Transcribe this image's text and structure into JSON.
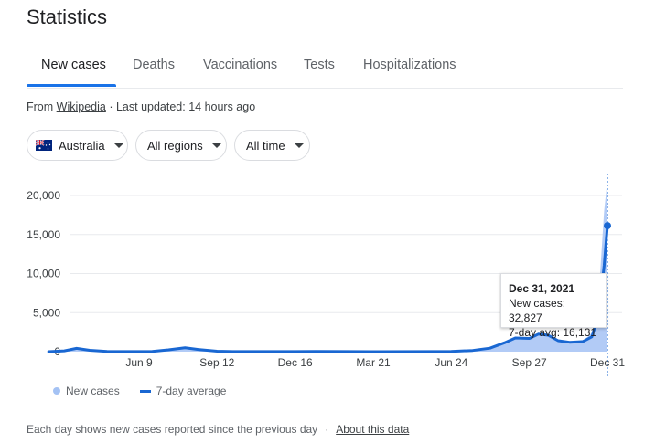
{
  "title": "Statistics",
  "tabs": [
    {
      "label": "New cases",
      "active": true
    },
    {
      "label": "Deaths",
      "active": false
    },
    {
      "label": "Vaccinations",
      "active": false
    },
    {
      "label": "Tests",
      "active": false
    },
    {
      "label": "Hospitalizations",
      "active": false
    }
  ],
  "source": {
    "prefix": "From",
    "link": "Wikipedia",
    "updated": "· Last updated: 14 hours ago"
  },
  "filters": {
    "country": "Australia",
    "region": "All regions",
    "time": "All time"
  },
  "tooltip": {
    "date": "Dec 31, 2021",
    "new_cases": "New cases: 32,827",
    "avg": "7-day avg: 16,131"
  },
  "legend": {
    "new_cases": "New cases",
    "avg": "7-day average"
  },
  "footer": {
    "note": "Each day shows new cases reported since the previous day",
    "separator": "·",
    "about": "About this data"
  },
  "colors": {
    "accent": "#1a73e8",
    "avg_line": "#1967d2",
    "cases_fill": "#a4c2f4"
  },
  "chart_data": {
    "type": "area",
    "title": "",
    "xlabel": "",
    "ylabel": "",
    "ylim": [
      0,
      22000
    ],
    "yticks": [
      0,
      5000,
      10000,
      15000,
      20000
    ],
    "ytick_labels": [
      "0",
      "5,000",
      "10,000",
      "15,000",
      "20,000"
    ],
    "xticks": [
      {
        "date": "2020-06-09",
        "label": "Jun 9"
      },
      {
        "date": "2020-09-12",
        "label": "Sep 12"
      },
      {
        "date": "2020-12-16",
        "label": "Dec 16"
      },
      {
        "date": "2021-03-21",
        "label": "Mar 21"
      },
      {
        "date": "2021-06-24",
        "label": "Jun 24"
      },
      {
        "date": "2021-09-27",
        "label": "Sep 27"
      },
      {
        "date": "2021-12-31",
        "label": "Dec 31"
      }
    ],
    "series": [
      {
        "name": "7-day average",
        "points": [
          [
            "2020-02-20",
            0
          ],
          [
            "2020-03-10",
            100
          ],
          [
            "2020-03-25",
            420
          ],
          [
            "2020-04-10",
            180
          ],
          [
            "2020-05-01",
            20
          ],
          [
            "2020-06-01",
            10
          ],
          [
            "2020-06-25",
            40
          ],
          [
            "2020-07-15",
            230
          ],
          [
            "2020-08-04",
            490
          ],
          [
            "2020-08-20",
            280
          ],
          [
            "2020-09-12",
            60
          ],
          [
            "2020-10-01",
            15
          ],
          [
            "2020-12-16",
            10
          ],
          [
            "2021-01-10",
            20
          ],
          [
            "2021-03-21",
            5
          ],
          [
            "2021-06-01",
            15
          ],
          [
            "2021-06-24",
            30
          ],
          [
            "2021-07-20",
            150
          ],
          [
            "2021-08-10",
            450
          ],
          [
            "2021-08-28",
            1150
          ],
          [
            "2021-09-10",
            1750
          ],
          [
            "2021-09-27",
            1700
          ],
          [
            "2021-10-08",
            2250
          ],
          [
            "2021-10-20",
            2100
          ],
          [
            "2021-11-01",
            1400
          ],
          [
            "2021-11-15",
            1200
          ],
          [
            "2021-12-01",
            1300
          ],
          [
            "2021-12-12",
            1900
          ],
          [
            "2021-12-20",
            4500
          ],
          [
            "2021-12-27",
            11000
          ],
          [
            "2021-12-31",
            16131
          ]
        ]
      },
      {
        "name": "New cases",
        "points": [
          [
            "2020-02-20",
            0
          ],
          [
            "2020-03-10",
            110
          ],
          [
            "2020-03-25",
            450
          ],
          [
            "2020-04-10",
            170
          ],
          [
            "2020-05-01",
            20
          ],
          [
            "2020-06-01",
            10
          ],
          [
            "2020-06-25",
            40
          ],
          [
            "2020-07-15",
            240
          ],
          [
            "2020-08-04",
            520
          ],
          [
            "2020-08-20",
            270
          ],
          [
            "2020-09-12",
            60
          ],
          [
            "2020-10-01",
            15
          ],
          [
            "2020-12-16",
            10
          ],
          [
            "2021-01-10",
            20
          ],
          [
            "2021-03-21",
            5
          ],
          [
            "2021-06-01",
            15
          ],
          [
            "2021-06-24",
            30
          ],
          [
            "2021-07-20",
            160
          ],
          [
            "2021-08-10",
            470
          ],
          [
            "2021-08-28",
            1200
          ],
          [
            "2021-09-10",
            1800
          ],
          [
            "2021-09-27",
            1650
          ],
          [
            "2021-10-08",
            2300
          ],
          [
            "2021-10-20",
            2050
          ],
          [
            "2021-11-01",
            1350
          ],
          [
            "2021-11-15",
            1150
          ],
          [
            "2021-12-01",
            1350
          ],
          [
            "2021-12-12",
            2400
          ],
          [
            "2021-12-20",
            6500
          ],
          [
            "2021-12-27",
            18000
          ],
          [
            "2021-12-31",
            32827
          ]
        ]
      }
    ],
    "highlight": {
      "date": "2021-12-31",
      "new_cases": 32827,
      "avg": 16131
    }
  }
}
